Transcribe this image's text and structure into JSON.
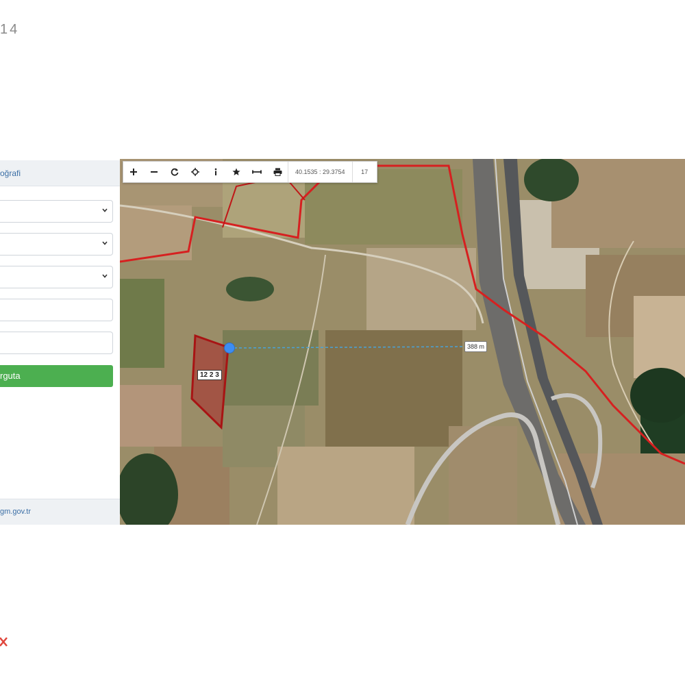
{
  "header": {
    "corner_text": "14"
  },
  "sidebar": {
    "header_label": "oğrafi",
    "submit_label": "rguta",
    "footer_link": "gm.gov.tr"
  },
  "map": {
    "toolbar": {
      "buttons": [
        "zoom-in",
        "zoom-out",
        "refresh",
        "locate",
        "info",
        "favorite",
        "measure",
        "print"
      ],
      "coordinates": "40.1535 : 29.3754",
      "zoom_level": "17"
    },
    "scale_label": "388 m",
    "parcel_label": "12 2 3"
  },
  "colors": {
    "accent_green": "#4caf50",
    "link_blue": "#3a6ea5",
    "boundary_red": "#d62020",
    "marker_blue": "#3d8df2"
  }
}
